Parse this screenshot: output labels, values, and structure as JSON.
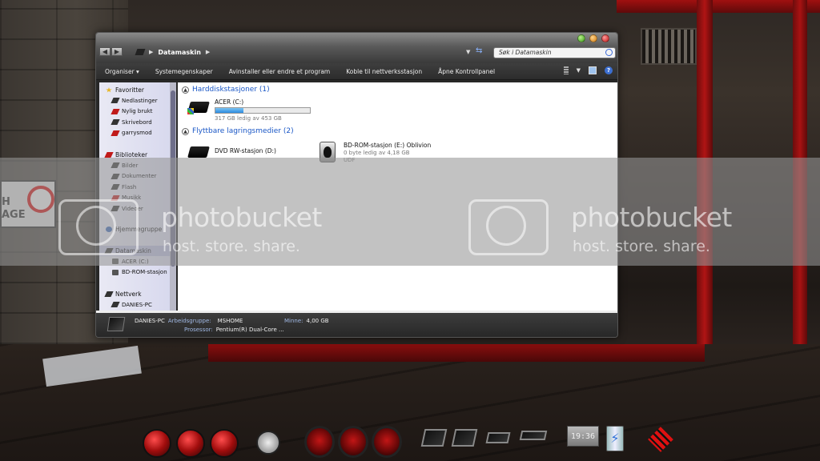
{
  "window": {
    "breadcrumb": "Datamaskin",
    "search_placeholder": "Søk i Datamaskin",
    "controls": [
      "minimize",
      "maximize",
      "close"
    ]
  },
  "toolbar": {
    "organize": "Organiser ▾",
    "system_properties": "Systemegenskaper",
    "uninstall": "Avinstaller eller endre et program",
    "map_drive": "Koble til nettverksstasjon",
    "control_panel": "Åpne Kontrollpanel"
  },
  "navpane": {
    "favorites": {
      "label": "Favoritter",
      "items": [
        "Nedlastinger",
        "Nylig brukt",
        "Skrivebord",
        "garrysmod"
      ]
    },
    "libraries": {
      "label": "Biblioteker",
      "items": [
        "Bilder",
        "Dokumenter",
        "Flash",
        "Musikk",
        "Videoer"
      ]
    },
    "homegroup": "Hjemmegruppe",
    "computer": {
      "label": "Datamaskin",
      "items": [
        "ACER (C:)",
        "BD-ROM-stasjon"
      ]
    },
    "network": {
      "label": "Nettverk",
      "items": [
        "DANIES-PC"
      ]
    }
  },
  "content": {
    "hdd_section": "Harddiskstasjoner (1)",
    "removable_section": "Flyttbare lagringsmedier (2)",
    "drives": {
      "c": {
        "name": "ACER (C:)",
        "free": "317 GB ledig av 453 GB",
        "used_fraction": 0.3
      },
      "dvd": {
        "name": "DVD RW-stasjon (D:)"
      },
      "bd": {
        "name": "BD-ROM-stasjon (E:) Oblivion",
        "free": "0 byte ledig av 4,18 GB",
        "fs": "UDF"
      }
    }
  },
  "details": {
    "pc_name": "DANIES-PC",
    "workgroup_label": "Arbeidsgruppe:",
    "workgroup_value": "MSHOME",
    "memory_label": "Minne:",
    "memory_value": "4,00 GB",
    "processor_label": "Prosessor:",
    "processor_value": "Pentium(R) Dual-Core ..."
  },
  "watermark": {
    "title": "photobucket",
    "subtitle": "host. store. share."
  },
  "desktop": {
    "sign_text": "H\nAGE",
    "clock": "19:36"
  }
}
